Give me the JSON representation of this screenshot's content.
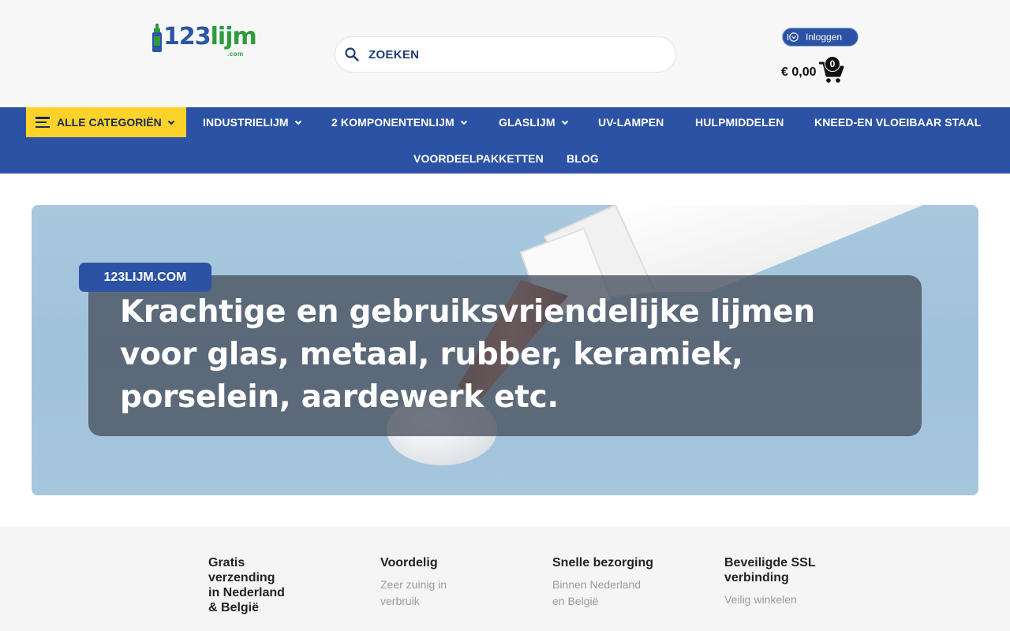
{
  "header": {
    "logo": {
      "number": "123",
      "word": "lijm",
      "suffix": ".com"
    },
    "search": {
      "placeholder": "ZOEKEN"
    },
    "login_label": "Inloggen",
    "cart": {
      "amount": "€ 0,00",
      "count": "0"
    }
  },
  "nav": {
    "categories_label": "ALLE CATEGORIËN",
    "items": [
      {
        "label": "INDUSTRIELIJM"
      },
      {
        "label": "2 KOMPONENTENLIJM"
      },
      {
        "label": "GLASLIJM"
      },
      {
        "label": "UV-LAMPEN"
      },
      {
        "label": "HULPMIDDELEN"
      },
      {
        "label": "KNEED-EN VLOEIBAAR STAAL"
      },
      {
        "label": "VOORDEELPAKKETTEN"
      },
      {
        "label": "BLOG"
      }
    ]
  },
  "hero": {
    "tag": "123LIJM.COM",
    "title": "Krachtige en gebruiksvriendelijke lijmen voor glas, metaal, rubber, keramiek, porselein, aardewerk etc."
  },
  "usps": [
    {
      "title": "Gratis verzending in Nederland & België",
      "subtitle": ""
    },
    {
      "title": "Voordelig",
      "subtitle": "Zeer zuinig in verbruik"
    },
    {
      "title": "Snelle bezorging",
      "subtitle": "Binnen Nederland en België"
    },
    {
      "title": "Beveiligde SSL verbinding",
      "subtitle": "Veilig winkelen"
    }
  ],
  "colors": {
    "brand_blue": "#2b52a4",
    "brand_green": "#2e9b3d",
    "accent_yellow": "#fdd22b"
  }
}
